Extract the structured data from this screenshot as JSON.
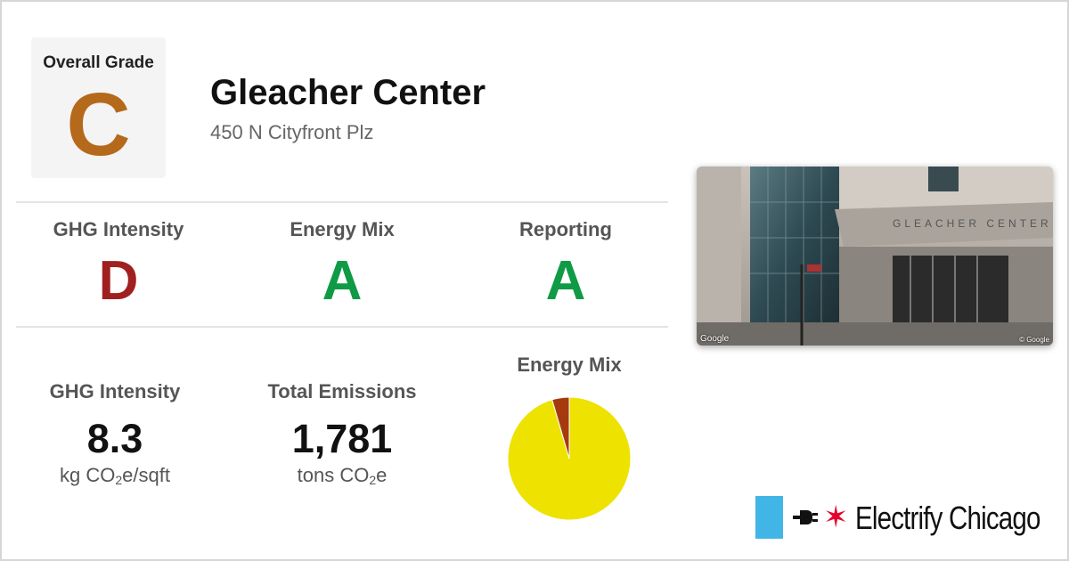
{
  "overall": {
    "label": "Overall Grade",
    "grade": "C",
    "grade_color": "#b5691a"
  },
  "building": {
    "name": "Gleacher Center",
    "address": "450 N Cityfront Plz"
  },
  "subgrades": [
    {
      "title": "GHG Intensity",
      "grade": "D",
      "color": "#a02020"
    },
    {
      "title": "Energy Mix",
      "grade": "A",
      "color": "#0f9b45"
    },
    {
      "title": "Reporting",
      "grade": "A",
      "color": "#0f9b45"
    }
  ],
  "stats": {
    "ghg": {
      "title": "GHG Intensity",
      "value": "8.3",
      "unit_pre": "kg CO",
      "unit_sub": "2",
      "unit_post": "e/sqft"
    },
    "emissions": {
      "title": "Total Emissions",
      "value": "1,781",
      "unit_pre": "tons CO",
      "unit_sub": "2",
      "unit_post": "e"
    }
  },
  "energy_mix": {
    "title": "Energy Mix"
  },
  "chart_data": {
    "type": "pie",
    "title": "Energy Mix",
    "slices": [
      {
        "value": 95.5,
        "color": "#ede200"
      },
      {
        "value": 4.5,
        "color": "#a63a0f"
      }
    ]
  },
  "photo": {
    "facade_text": "GLEACHER CENTER",
    "watermark_left": "Google",
    "watermark_right": "© Google"
  },
  "logo": {
    "text": "Electrify Chicago",
    "star": "✶",
    "flag_color": "#41b6e6",
    "star_color": "#e4002b"
  }
}
